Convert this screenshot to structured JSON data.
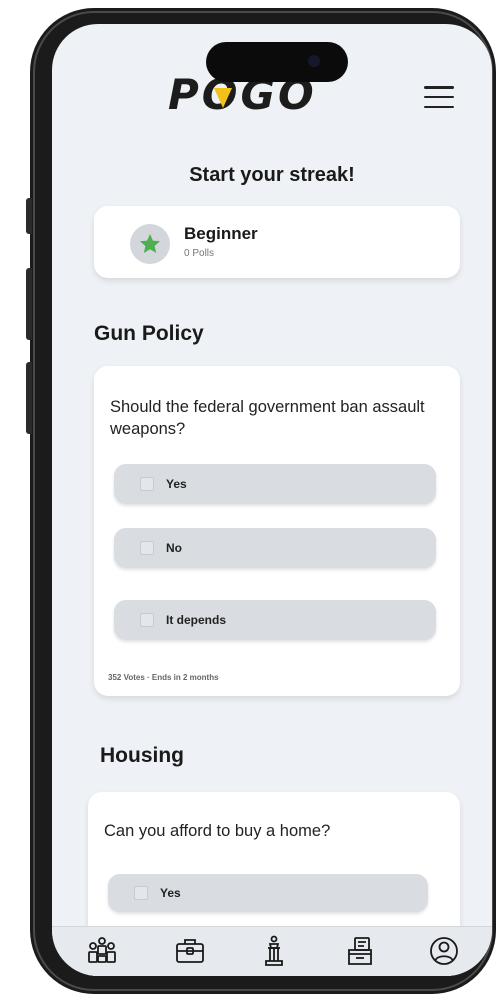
{
  "app": {
    "logo_text": "POGO",
    "accent_color": "#f2c21b"
  },
  "streak": {
    "title": "Start your streak!",
    "level_name": "Beginner",
    "level_polls": "0 Polls",
    "badge_icon": "star-icon",
    "badge_color": "#4caf50"
  },
  "polls": [
    {
      "category": "Gun Policy",
      "question": "Should the federal government ban assault weapons?",
      "options": [
        "Yes",
        "No",
        "It depends"
      ],
      "meta": "352 Votes · Ends in 2 months"
    },
    {
      "category": "Housing",
      "question": "Can you afford to buy a home?",
      "options": [
        "Yes"
      ]
    }
  ],
  "tabbar": {
    "items": [
      {
        "icon": "people-icon"
      },
      {
        "icon": "briefcase-icon"
      },
      {
        "icon": "podium-icon"
      },
      {
        "icon": "ballot-box-icon"
      },
      {
        "icon": "profile-icon"
      }
    ]
  }
}
